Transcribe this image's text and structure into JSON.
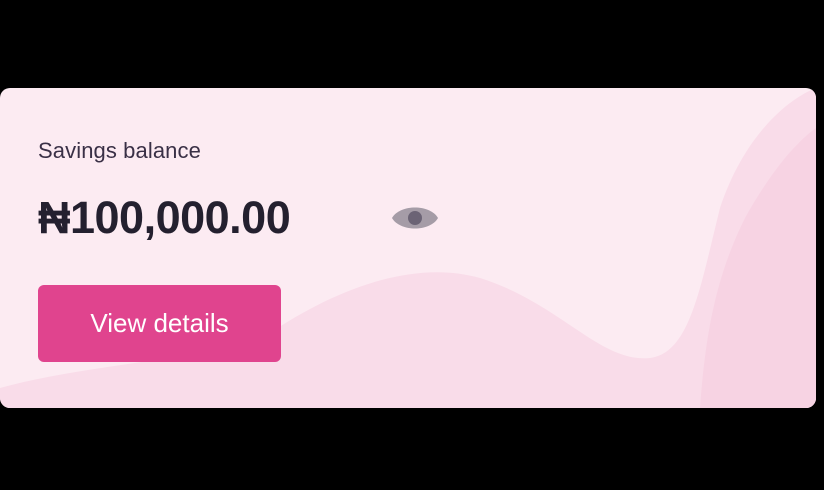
{
  "card": {
    "label": "Savings balance",
    "amount": "₦100,000.00",
    "button_label": "View details",
    "eye_icon": "eye-icon"
  },
  "colors": {
    "card_bg": "#fcebf2",
    "wave_light": "#f9dce9",
    "wave_mid": "#f7d3e3",
    "button_bg": "#e0448e",
    "text_dark": "#24202f",
    "icon_gray": "#a59ca7"
  }
}
